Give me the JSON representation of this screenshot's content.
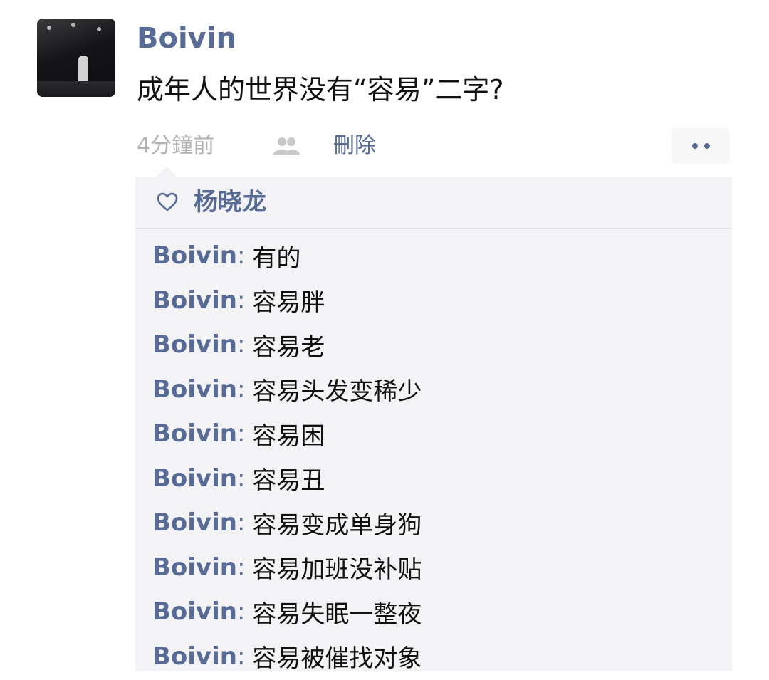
{
  "post": {
    "author": "Boivin",
    "text": "成年人的世界没有“容易”二字?",
    "time": "4分鐘前",
    "delete_label": "刪除"
  },
  "icons": {
    "avatar": "avatar-photo",
    "friends": "friends-icon",
    "more": "more-dots-icon",
    "heart": "heart-icon"
  },
  "colors": {
    "link": "#576b95",
    "comment_bg": "#f3f3f5",
    "muted": "#b2b2b2"
  },
  "likes": {
    "names": "杨晓龙"
  },
  "comments": [
    {
      "author": "Boivin",
      "sep": ":",
      "text": "有的"
    },
    {
      "author": "Boivin",
      "sep": ":",
      "text": "容易胖"
    },
    {
      "author": "Boivin",
      "sep": ":",
      "text": "容易老"
    },
    {
      "author": "Boivin",
      "sep": ":",
      "text": "容易头发变稀少"
    },
    {
      "author": "Boivin",
      "sep": ":",
      "text": "容易困"
    },
    {
      "author": "Boivin",
      "sep": ":",
      "text": "容易丑"
    },
    {
      "author": "Boivin",
      "sep": ":",
      "text": "容易变成单身狗"
    },
    {
      "author": "Boivin",
      "sep": ":",
      "text": "容易加班没补贴"
    },
    {
      "author": "Boivin",
      "sep": ":",
      "text": "容易失眠一整夜"
    },
    {
      "author": "Boivin",
      "sep": ":",
      "text": "容易被催找对象"
    }
  ]
}
